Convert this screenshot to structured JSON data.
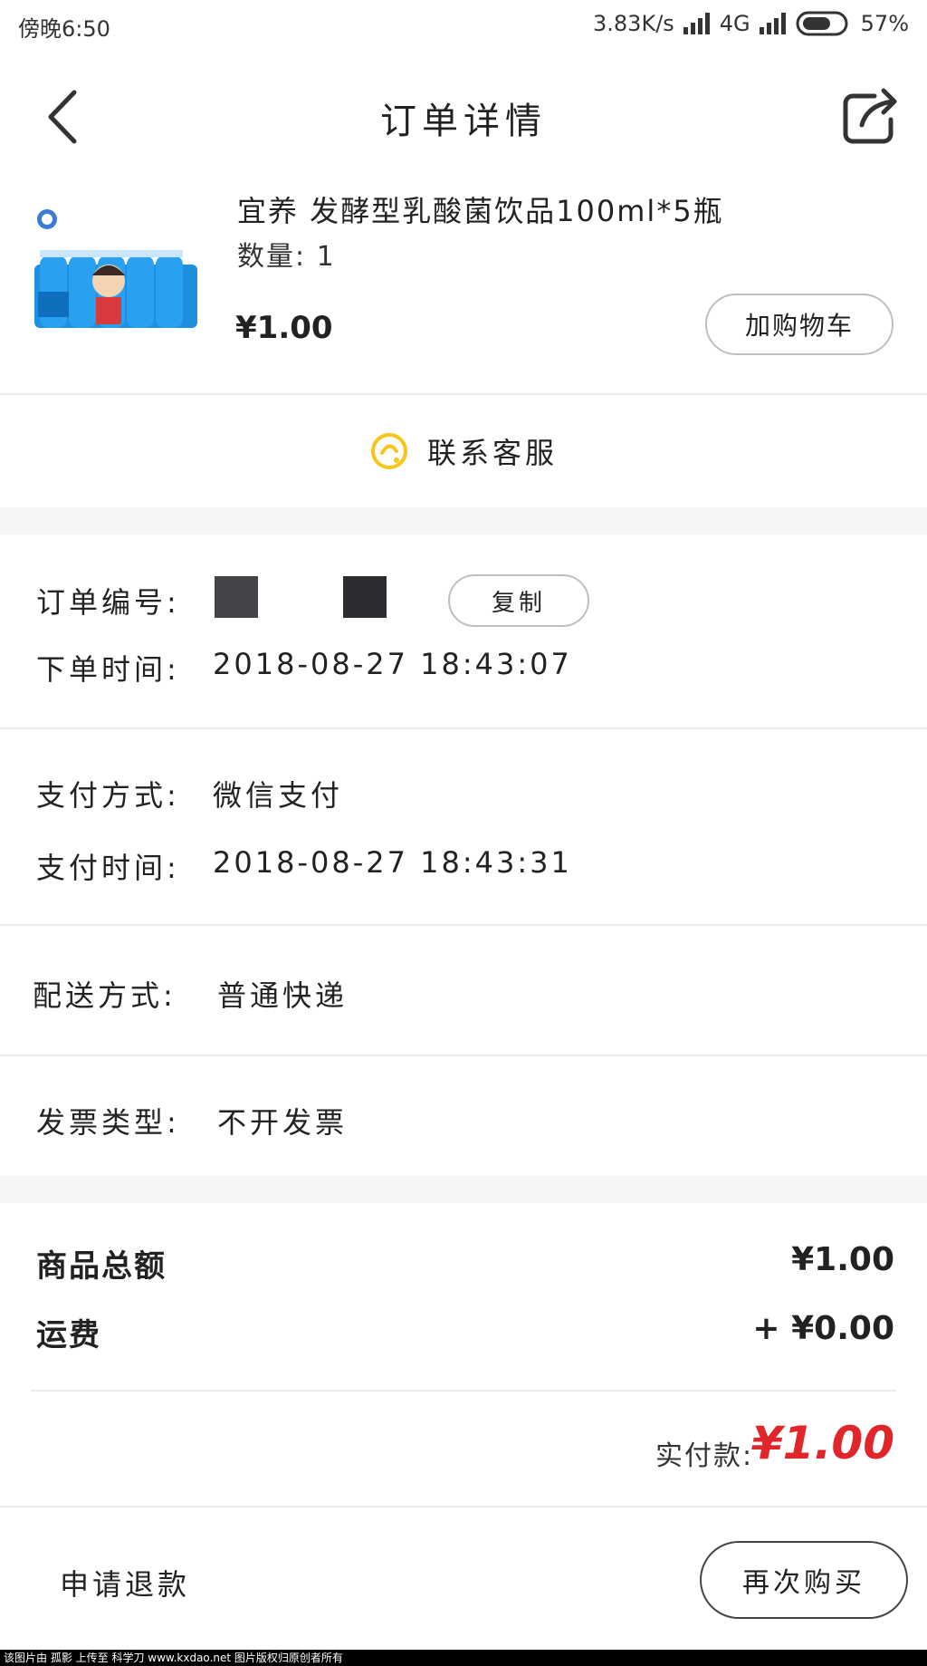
{
  "status_bar": {
    "time": "傍晚6:50",
    "speed": "3.83K/s",
    "network": "4G",
    "battery": "57%"
  },
  "header": {
    "title": "订单详情"
  },
  "product": {
    "name": "宜养 发酵型乳酸菌饮品100ml*5瓶",
    "quantity": "数量: 1",
    "price": "¥1.00",
    "add_to_cart": "加购物车"
  },
  "service": {
    "label": "联系客服",
    "icon_color": "#f5c518"
  },
  "order_info": {
    "order_no_label": "订单编号:",
    "copy_label": "复制",
    "order_time_label": "下单时间:",
    "order_time": "2018-08-27 18:43:07"
  },
  "payment": {
    "method_label": "支付方式:",
    "method": "微信支付",
    "time_label": "支付时间:",
    "time": "2018-08-27 18:43:31"
  },
  "delivery": {
    "label": "配送方式:",
    "value": "普通快递"
  },
  "invoice": {
    "label": "发票类型:",
    "value": "不开发票"
  },
  "summary": {
    "goods_total_label": "商品总额",
    "goods_total": "¥1.00",
    "shipping_label": "运费",
    "shipping": "+ ¥0.00",
    "paid_label": "实付款:",
    "paid": "¥1.00",
    "paid_color": "#e0262a"
  },
  "actions": {
    "refund": "申请退款",
    "rebuy": "再次购买"
  },
  "watermark": "该图片由 孤影 上传至 科学刀 www.kxdao.net 图片版权归原创者所有"
}
